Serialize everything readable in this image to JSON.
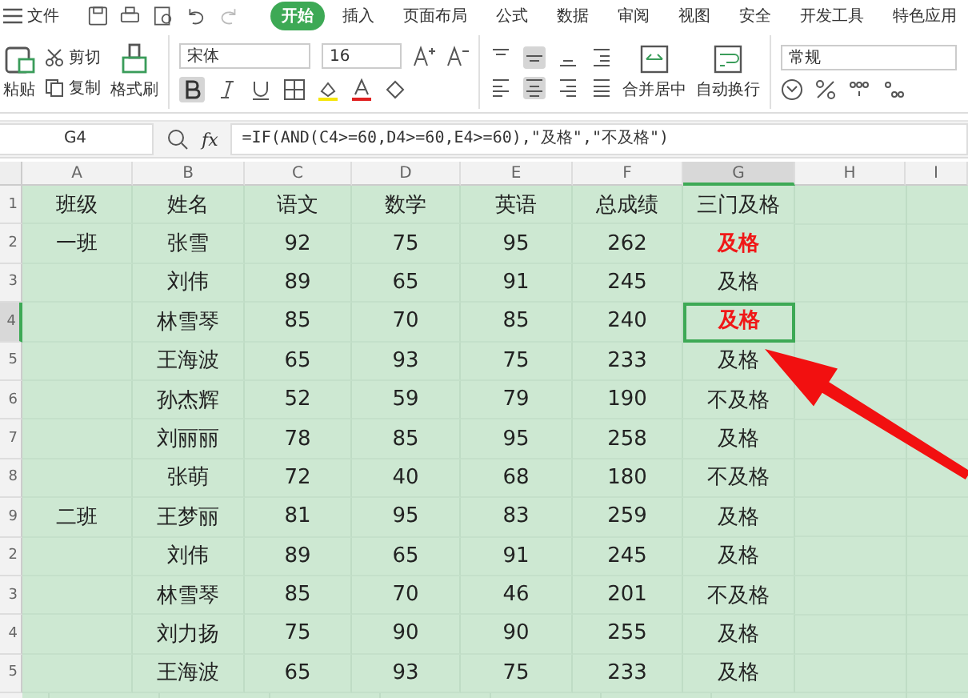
{
  "top_bar": {
    "file_menu": "文件",
    "tabs": [
      {
        "label": "开始",
        "selected": true
      },
      {
        "label": "插入",
        "selected": false
      },
      {
        "label": "页面布局",
        "selected": false
      },
      {
        "label": "公式",
        "selected": false
      },
      {
        "label": "数据",
        "selected": false
      },
      {
        "label": "审阅",
        "selected": false
      },
      {
        "label": "视图",
        "selected": false
      },
      {
        "label": "安全",
        "selected": false
      },
      {
        "label": "开发工具",
        "selected": false
      },
      {
        "label": "特色应用",
        "selected": false
      }
    ]
  },
  "ribbon": {
    "paste": "粘贴",
    "cut": "剪切",
    "copy": "复制",
    "format_painter": "格式刷",
    "font": "宋体",
    "font_size": "16",
    "merge_center": "合并居中",
    "wrap_text": "自动换行",
    "number_format": "常规"
  },
  "formula_bar": {
    "name_box": "G4",
    "fx": "fx",
    "formula": "=IF(AND(C4>=60,D4>=60,E4>=60),\"及格\",\"不及格\")"
  },
  "columns": [
    {
      "label": "A",
      "selected": false
    },
    {
      "label": "B",
      "selected": false
    },
    {
      "label": "C",
      "selected": false
    },
    {
      "label": "D",
      "selected": false
    },
    {
      "label": "E",
      "selected": false
    },
    {
      "label": "F",
      "selected": false
    },
    {
      "label": "G",
      "selected": true
    },
    {
      "label": "H",
      "selected": false
    },
    {
      "label": "I",
      "selected": false
    }
  ],
  "rows": [
    {
      "number": "1",
      "selected": false,
      "emphasis": false,
      "cells": [
        "班级",
        "姓名",
        "语文",
        "数学",
        "英语",
        "总成绩",
        "三门及格"
      ]
    },
    {
      "number": "2",
      "selected": false,
      "emphasis": true,
      "cells": [
        "一班",
        "张雪",
        "92",
        "75",
        "95",
        "262",
        "及格"
      ]
    },
    {
      "number": "3",
      "selected": false,
      "emphasis": false,
      "cells": [
        null,
        "刘伟",
        "89",
        "65",
        "91",
        "245",
        "及格"
      ]
    },
    {
      "number": "4",
      "selected": true,
      "emphasis": true,
      "cells": [
        null,
        "林雪琴",
        "85",
        "70",
        "85",
        "240",
        "及格"
      ]
    },
    {
      "number": "5",
      "selected": false,
      "emphasis": false,
      "cells": [
        null,
        "王海波",
        "65",
        "93",
        "75",
        "233",
        "及格"
      ]
    },
    {
      "number": "6",
      "selected": false,
      "emphasis": false,
      "cells": [
        null,
        "孙杰辉",
        "52",
        "59",
        "79",
        "190",
        "不及格"
      ]
    },
    {
      "number": "7",
      "selected": false,
      "emphasis": false,
      "cells": [
        null,
        "刘丽丽",
        "78",
        "85",
        "95",
        "258",
        "及格"
      ]
    },
    {
      "number": "8",
      "selected": false,
      "emphasis": false,
      "cells": [
        null,
        "张萌",
        "72",
        "40",
        "68",
        "180",
        "不及格"
      ]
    },
    {
      "number": "9",
      "selected": false,
      "emphasis": false,
      "cells": [
        "二班",
        "王梦丽",
        "81",
        "95",
        "83",
        "259",
        "及格"
      ]
    },
    {
      "number": "2",
      "selected": false,
      "emphasis": false,
      "cells": [
        null,
        "刘伟",
        "89",
        "65",
        "91",
        "245",
        "及格"
      ]
    },
    {
      "number": "3",
      "selected": false,
      "emphasis": false,
      "cells": [
        null,
        "林雪琴",
        "85",
        "70",
        "46",
        "201",
        "不及格"
      ]
    },
    {
      "number": "4",
      "selected": false,
      "emphasis": false,
      "cells": [
        null,
        "刘力扬",
        "75",
        "90",
        "90",
        "255",
        "及格"
      ]
    },
    {
      "number": "5",
      "selected": false,
      "emphasis": false,
      "cells": [
        null,
        "王海波",
        "65",
        "93",
        "75",
        "233",
        "及格"
      ]
    }
  ]
}
